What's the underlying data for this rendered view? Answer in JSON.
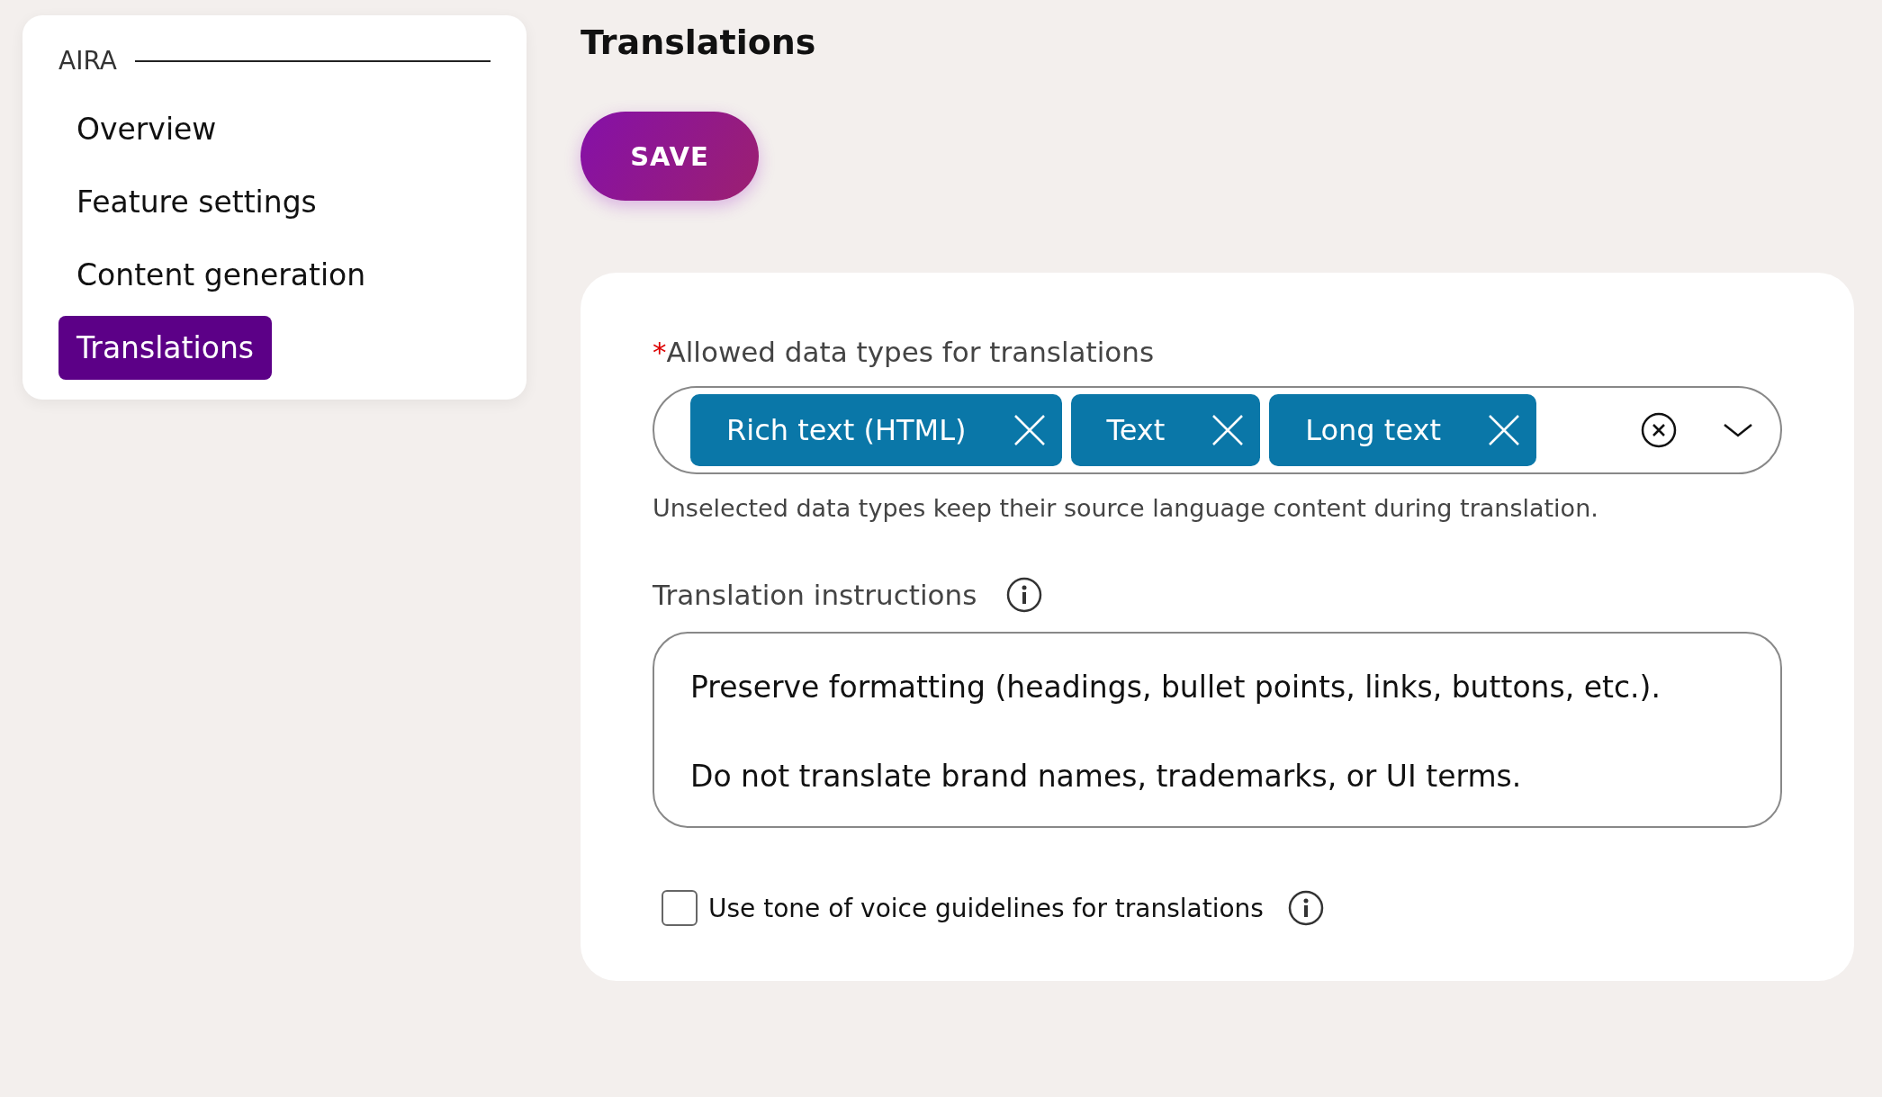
{
  "sidebar": {
    "section": "AIRA",
    "items": [
      {
        "label": "Overview",
        "selected": false
      },
      {
        "label": "Feature settings",
        "selected": false
      },
      {
        "label": "Content generation",
        "selected": false
      },
      {
        "label": "Translations",
        "selected": true
      }
    ]
  },
  "page_title": "Translations",
  "save_button": "SAVE",
  "form": {
    "data_types": {
      "required_mark": "*",
      "label": "Allowed data types for translations",
      "chips": [
        "Rich text (HTML)",
        "Text",
        "Long text"
      ],
      "help": "Unselected data types keep their source language content during translation."
    },
    "instructions": {
      "label": "Translation instructions",
      "lines": [
        "Preserve formatting (headings, bullet points, links, buttons, etc.).",
        "Do not translate brand names, trademarks, or UI terms."
      ]
    },
    "tone_checkbox": {
      "label": "Use tone of voice guidelines for translations",
      "checked": false
    }
  }
}
